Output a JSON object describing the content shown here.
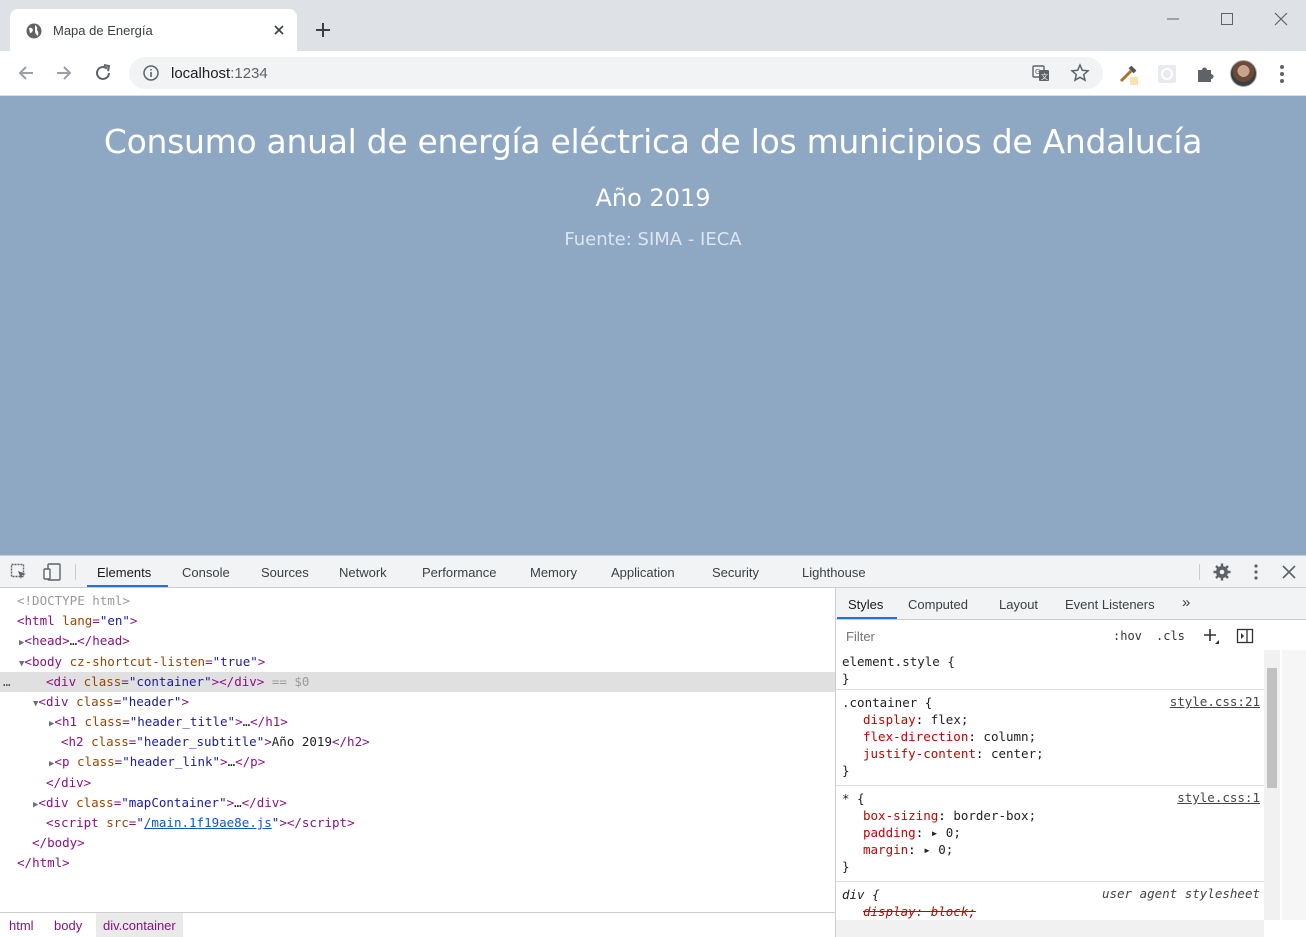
{
  "browser": {
    "tab_title": "Mapa de Energía",
    "url_host": "localhost",
    "url_port": ":1234"
  },
  "page": {
    "title": "Consumo anual de energía eléctrica de los municipios de Andalucía",
    "subtitle": "Año 2019",
    "link": "Fuente: SIMA - IECA"
  },
  "devtools": {
    "tabs": [
      "Elements",
      "Console",
      "Sources",
      "Network",
      "Performance",
      "Memory",
      "Application",
      "Security",
      "Lighthouse"
    ],
    "active_tab": "Elements",
    "dom": {
      "doctype": "<!DOCTYPE html>",
      "html_open_tag": "html",
      "html_lang_attr": "lang",
      "html_lang_val": "\"en\"",
      "head": "head",
      "head_ellipsis": "…",
      "body_tag": "body",
      "body_attr": "cz-shortcut-listen",
      "body_attr_val": "\"true\"",
      "container_tag": "div",
      "container_attr": "class",
      "container_val": "\"container\"",
      "selected_marker": "== $0",
      "header_val": "\"header\"",
      "h1_tag": "h1",
      "h1_val": "\"header_title\"",
      "h2_tag": "h2",
      "h2_val": "\"header_subtitle\"",
      "h2_text": "Año 2019",
      "p_tag": "p",
      "p_val": "\"header_link\"",
      "map_val": "\"mapContainer\"",
      "script_tag": "script",
      "script_attr": "src",
      "script_src": "/main.1f19ae8e.js",
      "ellipsis": "…",
      "row_dots": "…"
    },
    "breadcrumbs": [
      "html",
      "body",
      "div.container"
    ],
    "styles_tabs": [
      "Styles",
      "Computed",
      "Layout",
      "Event Listeners"
    ],
    "styles_more": "»",
    "filter_placeholder": "Filter",
    "hov": ":hov",
    "cls": ".cls",
    "rules": {
      "element_style": "element.style {",
      "close": "}",
      "container_selector": ".container {",
      "container_src": "style.css:21",
      "container_props": [
        {
          "name": "display",
          "value": "flex;"
        },
        {
          "name": "flex-direction",
          "value": "column;"
        },
        {
          "name": "justify-content",
          "value": "center;"
        }
      ],
      "star_selector": "* {",
      "star_src": "style.css:1",
      "star_props": [
        {
          "name": "box-sizing",
          "value": "border-box;"
        },
        {
          "name": "padding",
          "value": "▸ 0;"
        },
        {
          "name": "margin",
          "value": "▸ 0;"
        }
      ],
      "div_selector": "div {",
      "div_src": "user agent stylesheet",
      "div_prop": "display: block;"
    }
  }
}
